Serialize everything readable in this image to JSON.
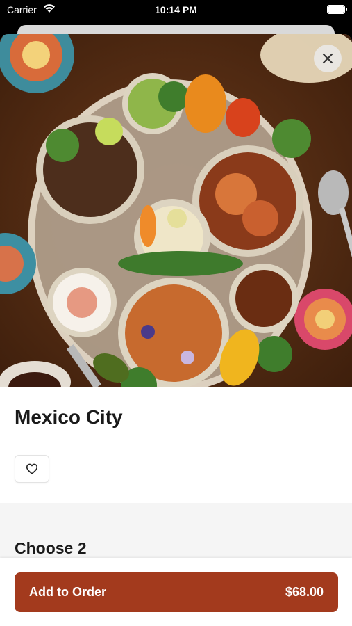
{
  "status_bar": {
    "carrier": "Carrier",
    "time": "10:14 PM",
    "battery_level": 1.0
  },
  "hero": {
    "image_subject": "food-platter-photo",
    "close_icon": "close-icon"
  },
  "item": {
    "title": "Mexico City",
    "favorite_icon": "heart-icon"
  },
  "options": {
    "section_title": "Choose 2"
  },
  "order": {
    "button_label": "Add to Order",
    "price": "$68.00",
    "accent_color": "#a33a1d"
  }
}
